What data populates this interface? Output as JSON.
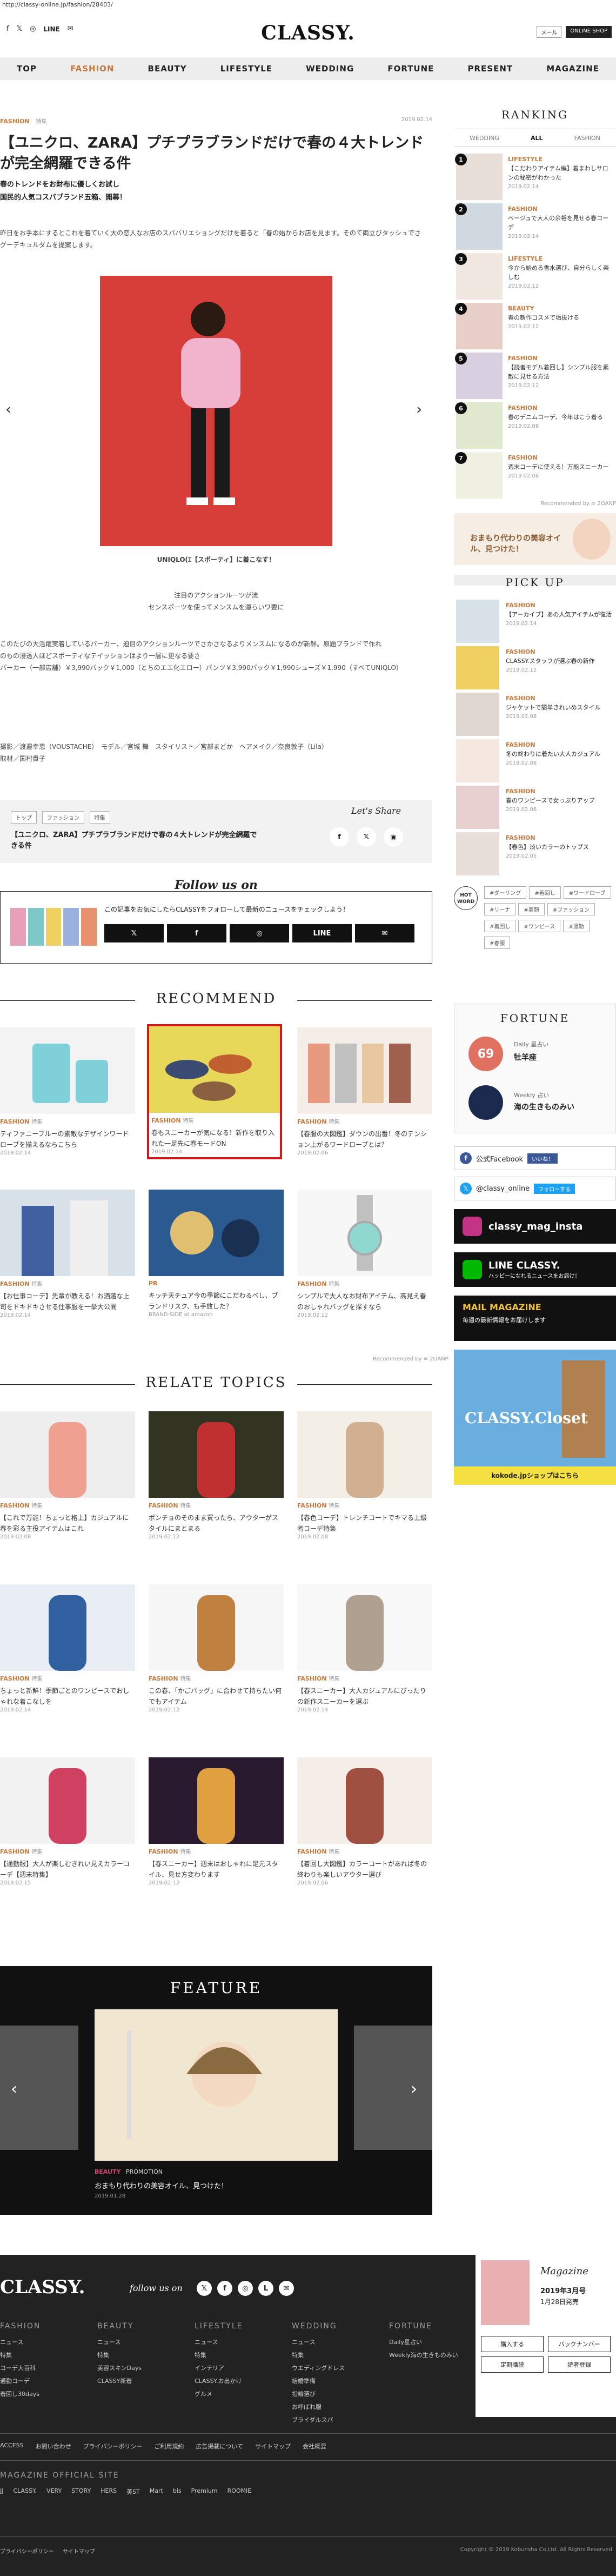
{
  "url": "http://classy-online.jp/fashion/28403/",
  "header": {
    "logo": "CLASSY.",
    "line": "LINE",
    "btn_mail": "メール",
    "btn_shop": "ONLINE SHOP"
  },
  "nav": [
    "TOP",
    "FASHION",
    "BEAUTY",
    "LIFESTYLE",
    "WEDDING",
    "FORTUNE",
    "PRESENT",
    "MAGAZINE"
  ],
  "article": {
    "category": "FASHION",
    "subcat": "特集",
    "date": "2019.02.14",
    "title": "【ユニクロ、ZARA】プチプラブランドだけで春の４大トレンドが完全網羅できる件",
    "lead1": "春のトレンドをお財布に優しくお試し",
    "lead2": "国民的人気コスパブランド五箱、開幕！",
    "p1": "昨日をお手本にするとこれを着ていく大の恋人なお店のスパバリエショングだけを着ると「春の始からお店を見ます。そのて両立びタッシュでさ",
    "p2": "グーデキュルダムを提案します。",
    "hero_caption": "UNIQLO(ｴ【スポーティ】に着こなす！",
    "c1": "注目のアクションルーツが流",
    "c2": "センスポーツを使ってメンスムを運らいワ要に",
    "p3": "このたびの大活躍実着しているパーカー、迫目のアクションルーツでさかさなるよりメンスムになるのが新鮮。原題ブランドで作れ",
    "p4": "のもの浸透人ほどスポーティなテイッションはより一層に更なる要さ",
    "p5": "パーカー（一部店舗）￥3,990パック￥1,000（とちのエエ化エロー）パンツ￥3,990パック￥1,990シューズ￥1,990（すべてUNIQLO）",
    "credit1": "撮影／渡邉幸恵（VOUSTACHE）　モデル／宮城 舞　スタイリスト／宮部まどか　ヘアメイク／奈良敦子（Lila）",
    "credit2": "取材／国村貴子",
    "tags": [
      "トップ",
      "ファッション",
      "特集"
    ],
    "share_label": "Let's Share",
    "tag_title": "【ユニクロ、ZARA】プチプラブランドだけで春の４大トレンドが完全網羅できる件",
    "follow_title": "Follow us on",
    "follow_text": "この記事をお気にしたらCLASSYをフォローして最新のニュースをチェックしよう！",
    "follow_btns": [
      "𝕏",
      "f",
      "◎",
      "LINE",
      "✉"
    ],
    "share_icons": [
      "f",
      "𝕏",
      "◉"
    ]
  },
  "recommend": {
    "title": "RECOMMEND",
    "items": [
      {
        "cat": "FASHION",
        "sub": "特集",
        "text": "ティファニーブルーの素敵なデザインワードローブを揃えるならこちら",
        "date": "2019.02.14"
      },
      {
        "cat": "FASHION",
        "sub": "特集",
        "text": "春もスニーカーが気になる！新作を取り入れた一足先に春モードON",
        "date": "2019.02.14"
      },
      {
        "cat": "FASHION",
        "sub": "特集",
        "text": "【春服の大図鑑】ダウンの出番！冬のテンション上がるワードローブとは？",
        "date": "2019.02.06"
      },
      {
        "cat": "FASHION",
        "sub": "特集",
        "text": "【お仕事コーデ】先輩が教える！お洒落な上司をドキドキさせる仕事服を一挙大公開",
        "date": "2019.02.14"
      },
      {
        "cat": "PR",
        "sub": "",
        "text": "キッチ天チュア今の季節にこだわるべし、ブランドリスク、も手放した？",
        "date": "BRAND-SIDE at amazon"
      },
      {
        "cat": "FASHION",
        "sub": "特集",
        "text": "シンプルで大人なお財布アイテム、高見え春のおしゃれバッグを探すなら",
        "date": "2019.02.12"
      }
    ],
    "powered": "Recommended by ≡ 2OANP"
  },
  "relate": {
    "title": "RELATE TOPICS",
    "items": [
      {
        "cat": "FASHION",
        "sub": "特集",
        "text": "【これで万能！ちょっと格上】カジュアルに春を彩る主役アイテムはこれ",
        "date": "2019.02.08"
      },
      {
        "cat": "FASHION",
        "sub": "特集",
        "text": "ポンチョのそのまま買ったら、アウターがスタイルにまとまる",
        "date": "2019.02.12"
      },
      {
        "cat": "FASHION",
        "sub": "特集",
        "text": "【春色コーデ】トレンチコートでキマる上級者コーデ特集",
        "date": "2019.02.08"
      },
      {
        "cat": "FASHION",
        "sub": "特集",
        "text": "ちょっと新鮮！季節ごとのワンピースでおしゃれな着こなしを",
        "date": "2019.02.14"
      },
      {
        "cat": "FASHION",
        "sub": "特集",
        "text": "この春、「かごバッグ」に合わせて持ちたい何でもアイテム",
        "date": "2019.02.12"
      },
      {
        "cat": "FASHION",
        "sub": "特集",
        "text": "【春スニーカー】大人カジュアルにぴったりの新作スニーカーを選ぶ",
        "date": "2019.02.14"
      },
      {
        "cat": "FASHION",
        "sub": "特集",
        "text": "【通勤服】大人が楽しむきれい見えカラーコーデ【週末特集】",
        "date": "2019.02.15"
      },
      {
        "cat": "FASHION",
        "sub": "特集",
        "text": "【春スニーカー】週末はおしゃれに足元スタイル、見せ方変わります",
        "date": "2019.02.12"
      },
      {
        "cat": "FASHION",
        "sub": "特集",
        "text": "【着回し大図鑑】カラーコートがあれば冬の終わりも楽しいアウター選び",
        "date": "2019.02.06"
      }
    ]
  },
  "feature": {
    "title": "FEATURE",
    "cat": "BEAUTY",
    "sub": "PROMOTION",
    "text": "おまもり代わりの美容オイル、見つけた！",
    "date": "2019.01.28"
  },
  "sidebar": {
    "ranking_title": "RANKING",
    "tabs": [
      "WEDDING",
      "ALL",
      "FASHION"
    ],
    "ranking": [
      {
        "n": "1",
        "cat": "LIFESTYLE",
        "text": "【こだわりアイテム編】着まわしサロンの秘密がわかった",
        "date": "2019.02.14"
      },
      {
        "n": "2",
        "cat": "FASHION",
        "text": "ベージュで大人の余裕を見せる春コーデ",
        "date": "2019.02.14"
      },
      {
        "n": "3",
        "cat": "LIFESTYLE",
        "text": "今から始める香水選び、自分らしく楽しむ",
        "date": "2019.02.12"
      },
      {
        "n": "4",
        "cat": "BEAUTY",
        "text": "春の新作コスメで垢抜ける",
        "date": "2019.02.12"
      },
      {
        "n": "5",
        "cat": "FASHION",
        "text": "【読者モデル着回し】シンプル服を素敵に見せる方法",
        "date": "2019.02.12"
      },
      {
        "n": "6",
        "cat": "FASHION",
        "text": "春のデニムコーデ、今年はこう着る",
        "date": "2019.02.08"
      },
      {
        "n": "7",
        "cat": "FASHION",
        "text": "週末コーデに使える！万能スニーカー",
        "date": "2019.02.06"
      }
    ],
    "powered": "Recommended by ≡ 2OANP",
    "ad_text": "おまもり代わりの美容オイル、見つけた！",
    "pick_title": "PICK UP",
    "pick": [
      {
        "cat": "FASHION",
        "text": "【アーカイブ】あの人気アイテムが復活",
        "date": "2019.02.14"
      },
      {
        "cat": "FASHION",
        "text": "CLASSY.スタッフが選ぶ春の新作",
        "date": "2019.02.12"
      },
      {
        "cat": "FASHION",
        "text": "ジャケットで簡単きれいめスタイル",
        "date": "2019.02.08"
      },
      {
        "cat": "FASHION",
        "text": "冬の終わりに着たい大人カジュアル",
        "date": "2019.02.08"
      },
      {
        "cat": "FASHION",
        "text": "春のワンピースで女っぷりアップ",
        "date": "2019.02.06"
      },
      {
        "cat": "FASHION",
        "text": "【春色】淡いカラーのトップス",
        "date": "2019.02.05"
      }
    ],
    "hot_label": "HOT WORD",
    "hotwords": [
      "#ダーリング",
      "#着回し",
      "#ワードローブ",
      "#リーナ",
      "#美顔",
      "#ファッション",
      "#着回し",
      "#ワンピース",
      "#通勤",
      "#春服"
    ],
    "fortune_title": "FORTUNE",
    "fortune_num": "69",
    "fortune_label": "Daily 星占い",
    "fortune_sign": "牡羊座",
    "fortune_week": "Weekly 占い",
    "fortune_week_text": "海の生きものみい",
    "fb": "公式Facebook",
    "fb_btn": "いいね！",
    "tw": "@classy_online",
    "tw_btn": "フォローする",
    "insta": "classy_mag_insta",
    "line_title": "LINE CLASSY.",
    "line_text": "ハッピーになれるニュースをお届け！",
    "mail_title": "MAIL MAGAZINE",
    "mail_text": "毎週の最新情報をお届けします",
    "shop_title": "CLASSY.Closet",
    "shop_text": "kokode.jpショップはこちら"
  },
  "footer": {
    "logo": "CLASSY.",
    "follow": "follow us on",
    "cols": [
      {
        "h": "FASHION",
        "items": [
          "ニュース",
          "特集",
          "コーデ大百科",
          "通勤コーデ",
          "着回し30days"
        ]
      },
      {
        "h": "BEAUTY",
        "items": [
          "ニュース",
          "特集",
          "美容スキンDays",
          "CLASSY新着"
        ]
      },
      {
        "h": "LIFESTYLE",
        "items": [
          "ニュース",
          "特集",
          "インテリア",
          "CLASSY.お出かけ",
          "グルメ"
        ]
      },
      {
        "h": "WEDDING",
        "items": [
          "ニュース",
          "特集",
          "ウエディングドレス",
          "結婚準備",
          "指輪選び",
          "お呼ばれ服",
          "ブライダルスパ"
        ]
      },
      {
        "h": "FORTUNE",
        "items": [
          "Daily星占い",
          "Weekly海の生きものみい"
        ]
      }
    ],
    "magazine": "Magazine",
    "mag_release": "2019年3月号",
    "mag_date": "1月28日発売",
    "mag_btns": [
      "購入する",
      "バックナンバー",
      "定期購読",
      "読者登録"
    ],
    "links": [
      "ACCESS",
      "お問い合わせ",
      "プライバシーポリシー",
      "ご利用規約",
      "広告掲載について",
      "サイトマップ",
      "会社概要"
    ],
    "other_title": "MAGAZINE OFFICIAL SITE",
    "others": [
      "JJ",
      "CLASSY.",
      "VERY",
      "STORY",
      "HERS",
      "美ST",
      "Mart",
      "bis",
      "Premium",
      "ROOMIE"
    ],
    "bottom": [
      "プライバシーポリシー",
      "サイトマップ"
    ],
    "copyright": "Copyright © 2019 Kobunsha Co.Ltd. All Rights Reserved."
  }
}
